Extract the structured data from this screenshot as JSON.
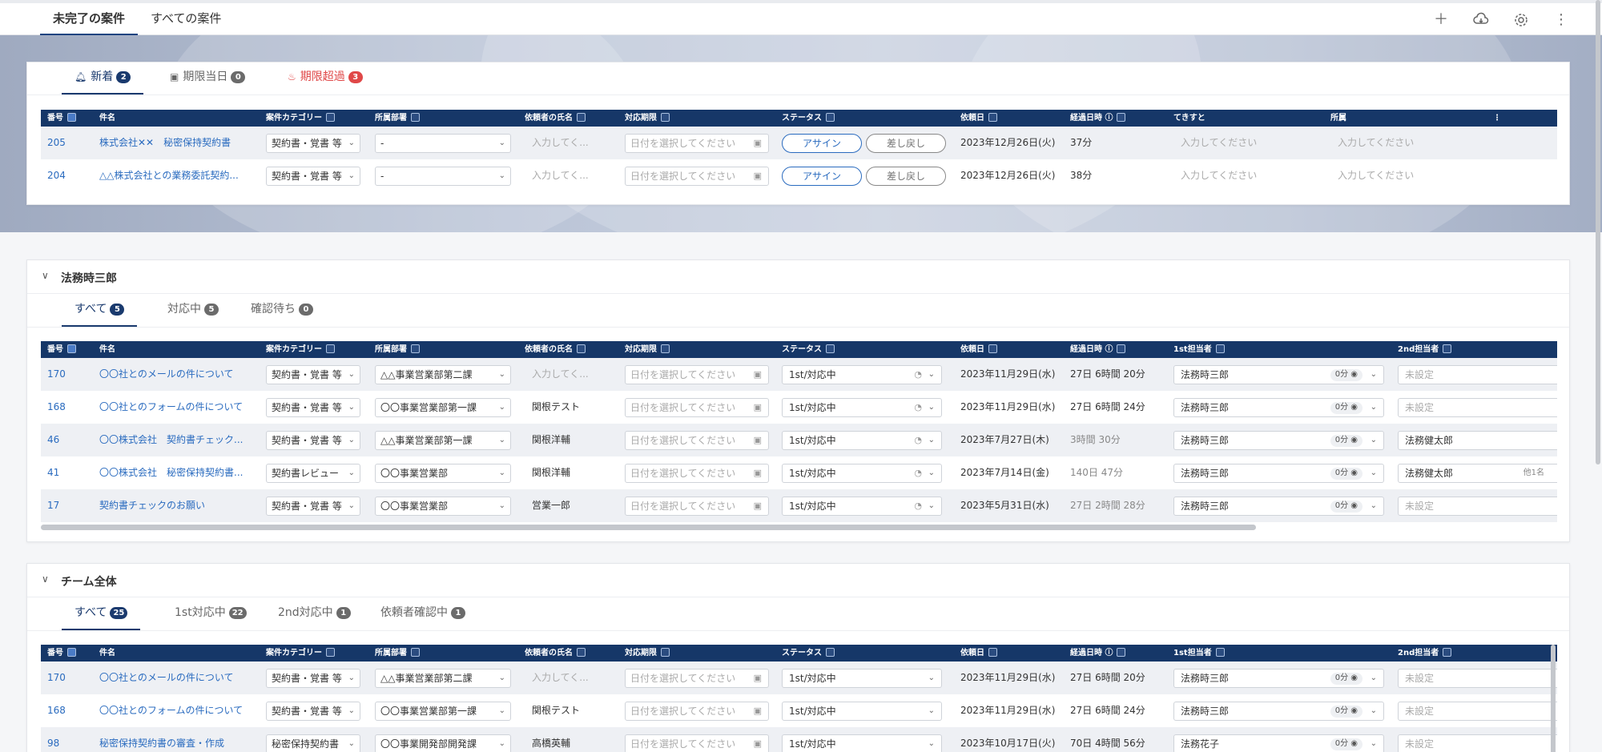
{
  "top_tabs": [
    "未完了の案件",
    "すべての案件"
  ],
  "cols1": {
    "num": "番号",
    "title": "件名",
    "category": "案件カテゴリー",
    "dept": "所属部署",
    "requester": "依頼者の氏名",
    "deadline": "対応期限",
    "status": "ステータス",
    "reqdate": "依頼日",
    "elapsed": "経過日時",
    "tekisuto": "てきすと",
    "affil": "所属"
  },
  "cols2": {
    "num": "番号",
    "title": "件名",
    "category": "案件カテゴリー",
    "dept": "所属部署",
    "requester": "依頼者の氏名",
    "deadline": "対応期限",
    "status": "ステータス",
    "reqdate": "依頼日",
    "elapsed": "経過日時",
    "first": "1st担当者",
    "second": "2nd担当者"
  },
  "card1": {
    "tabs": [
      {
        "label": "新着",
        "count": "2"
      },
      {
        "label": "期限当日",
        "count": "0"
      },
      {
        "label": "期限超過",
        "count": "3"
      }
    ],
    "rows": [
      {
        "num": "205",
        "title": "株式会社✕✕　秘密保持契約書",
        "category": "契約書・覚書 等",
        "dept": "-",
        "requester": "入力してく...",
        "deadline": "日付を選択してください",
        "btn_assign": "アサイン",
        "btn_return": "差し戻し",
        "reqdate": "2023年12月26日(火)",
        "elapsed": "37分",
        "tekisuto": "入力してください",
        "affil": "入力してください"
      },
      {
        "num": "204",
        "title": "△△株式会社との業務委託契約...",
        "category": "契約書・覚書 等",
        "dept": "-",
        "requester": "入力してく...",
        "deadline": "日付を選択してください",
        "btn_assign": "アサイン",
        "btn_return": "差し戻し",
        "reqdate": "2023年12月26日(火)",
        "elapsed": "38分",
        "tekisuto": "入力してください",
        "affil": "入力してください"
      }
    ]
  },
  "card2": {
    "title": "法務時三郎",
    "tabs": [
      {
        "label": "すべて",
        "count": "5"
      },
      {
        "label": "対応中",
        "count": "5"
      },
      {
        "label": "確認待ち",
        "count": "0"
      }
    ],
    "rows": [
      {
        "num": "170",
        "title": "〇〇社とのメールの件について",
        "category": "契約書・覚書 等",
        "dept": "△△事業営業部第二課",
        "requester": "入力してく...",
        "deadline": "日付を選択してください",
        "status": "1st/対応中",
        "reqdate": "2023年11月29日(水)",
        "elapsed": "27日 6時間 20分",
        "first": "法務時三郎",
        "first_time": "0分",
        "second": "未設定",
        "second_extra": ""
      },
      {
        "num": "168",
        "title": "〇〇社とのフォームの件について",
        "category": "契約書・覚書 等",
        "dept": "〇〇事業営業部第一課",
        "requester": "関根テスト",
        "deadline": "日付を選択してください",
        "status": "1st/対応中",
        "reqdate": "2023年11月29日(水)",
        "elapsed": "27日 6時間 24分",
        "first": "法務時三郎",
        "first_time": "0分",
        "second": "未設定",
        "second_extra": ""
      },
      {
        "num": "46",
        "title": "〇〇株式会社　契約書チェック...",
        "category": "契約書・覚書 等",
        "dept": "△△事業営業部第一課",
        "requester": "関根洋輔",
        "deadline": "日付を選択してください",
        "status": "1st/対応中",
        "reqdate": "2023年7月27日(木)",
        "elapsed": "3時間 30分",
        "first": "法務時三郎",
        "first_time": "0分",
        "second": "法務健太郎",
        "second_extra": ""
      },
      {
        "num": "41",
        "title": "〇〇株式会社　秘密保持契約書...",
        "category": "契約書レビュー",
        "dept": "〇〇事業営業部",
        "requester": "関根洋輔",
        "deadline": "日付を選択してください",
        "status": "1st/対応中",
        "reqdate": "2023年7月14日(金)",
        "elapsed": "140日 47分",
        "first": "法務時三郎",
        "first_time": "0分",
        "second": "法務健太郎",
        "second_extra": "他1名"
      },
      {
        "num": "17",
        "title": "契約書チェックのお願い",
        "category": "契約書・覚書 等",
        "dept": "〇〇事業営業部",
        "requester": "営業一郎",
        "deadline": "日付を選択してください",
        "status": "1st/対応中",
        "reqdate": "2023年5月31日(水)",
        "elapsed": "27日 2時間 28分",
        "first": "法務時三郎",
        "first_time": "0分",
        "second": "未設定",
        "second_extra": ""
      }
    ]
  },
  "card3": {
    "title": "チーム全体",
    "tabs": [
      {
        "label": "すべて",
        "count": "25"
      },
      {
        "label": "1st対応中",
        "count": "22"
      },
      {
        "label": "2nd対応中",
        "count": "1"
      },
      {
        "label": "依頼者確認中",
        "count": "1"
      }
    ],
    "rows": [
      {
        "num": "170",
        "title": "〇〇社とのメールの件について",
        "category": "契約書・覚書 等",
        "dept": "△△事業営業部第二課",
        "requester": "入力してく...",
        "deadline": "日付を選択してください",
        "status": "1st/対応中",
        "reqdate": "2023年11月29日(水)",
        "elapsed": "27日 6時間 20分",
        "first": "法務時三郎",
        "first_time": "0分",
        "second": "未設定",
        "second_extra": ""
      },
      {
        "num": "168",
        "title": "〇〇社とのフォームの件について",
        "category": "契約書・覚書 等",
        "dept": "〇〇事業営業部第一課",
        "requester": "関根テスト",
        "deadline": "日付を選択してください",
        "status": "1st/対応中",
        "reqdate": "2023年11月29日(水)",
        "elapsed": "27日 6時間 24分",
        "first": "法務時三郎",
        "first_time": "0分",
        "second": "未設定",
        "second_extra": ""
      },
      {
        "num": "98",
        "title": "秘密保持契約書の審査・作成",
        "category": "秘密保持契約書",
        "dept": "〇〇事業開発部開発課",
        "requester": "高橋英輔",
        "deadline": "日付を選択してください",
        "status": "1st/対応中",
        "reqdate": "2023年10月17日(火)",
        "elapsed": "70日 4時間 56分",
        "first": "法務花子",
        "first_time": "0分",
        "second": "未設定",
        "second_extra": ""
      }
    ]
  }
}
